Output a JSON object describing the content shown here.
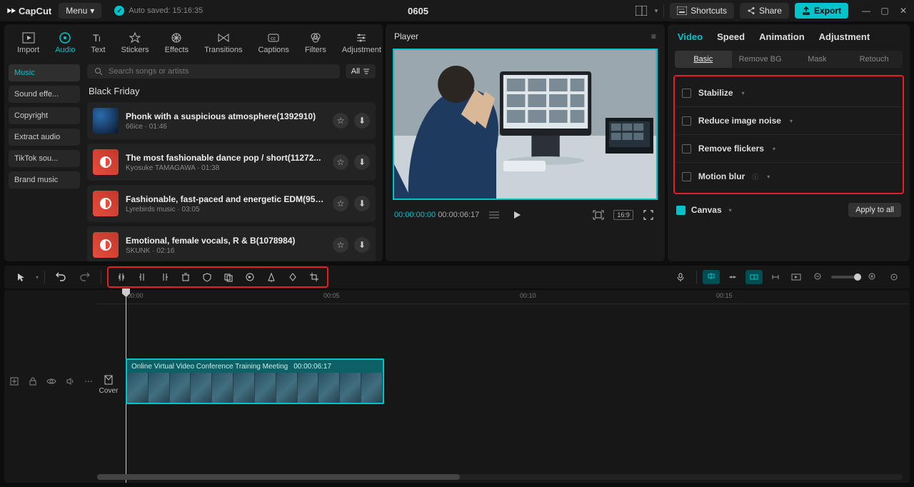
{
  "titlebar": {
    "logo": "CapCut",
    "menu": "Menu",
    "autosave": "Auto saved: 15:16:35",
    "project": "0605",
    "shortcuts": "Shortcuts",
    "share": "Share",
    "export": "Export"
  },
  "import_tabs": {
    "import": "Import",
    "audio": "Audio",
    "text": "Text",
    "stickers": "Stickers",
    "effects": "Effects",
    "transitions": "Transitions",
    "captions": "Captions",
    "filters": "Filters",
    "adjustment": "Adjustment"
  },
  "categories": [
    "Music",
    "Sound effe...",
    "Copyright",
    "Extract audio",
    "TikTok sou...",
    "Brand music"
  ],
  "search_placeholder": "Search songs or artists",
  "filter_all": "All",
  "section_title": "Black Friday",
  "songs": [
    {
      "title": "Phonk with a suspicious atmosphere(1392910)",
      "meta": "66ice · 01:46"
    },
    {
      "title": "The most fashionable dance pop / short(11272...",
      "meta": "Kyosuke TAMAGAWA · 01:38"
    },
    {
      "title": "Fashionable, fast-paced and energetic EDM(959...",
      "meta": "Lyrebirds music · 03:05"
    },
    {
      "title": "Emotional, female vocals, R & B(1078984)",
      "meta": "SKUNK · 02:16"
    }
  ],
  "player": {
    "title": "Player",
    "current": "00:00:00:00",
    "duration": "00:00:06:17",
    "ratio": "16:9"
  },
  "right_tabs": [
    "Video",
    "Speed",
    "Animation",
    "Adjustment"
  ],
  "sub_tabs": [
    "Basic",
    "Remove BG",
    "Mask",
    "Retouch"
  ],
  "options": [
    "Stabilize",
    "Reduce image noise",
    "Remove flickers",
    "Motion blur"
  ],
  "canvas_label": "Canvas",
  "apply_all": "Apply to all",
  "ruler": {
    "t0": "00:00",
    "t1": "00:05",
    "t2": "00:10",
    "t3": "00:15"
  },
  "cover": "Cover",
  "clip": {
    "name": "Online Virtual Video Conference Training Meeting",
    "dur": "00:00:06:17"
  }
}
